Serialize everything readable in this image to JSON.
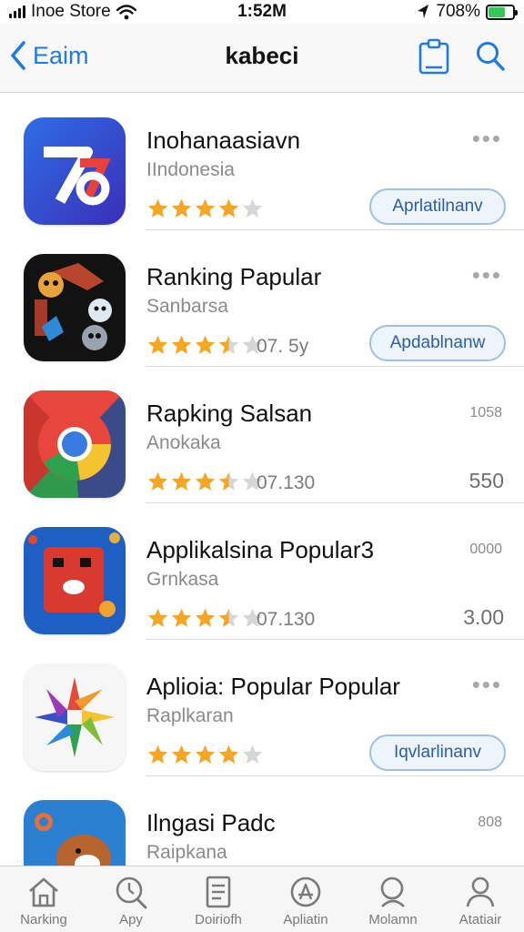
{
  "status_bar": {
    "carrier": "Inoe Store",
    "time": "1:52M",
    "battery": "708%"
  },
  "nav": {
    "back_label": "Eaim",
    "title": "kabeci"
  },
  "apps": [
    {
      "name": "Inohanaasiavn",
      "category": "IIndonesia",
      "rating": 4,
      "rating_count": "",
      "more": "•••",
      "action": "Aprlatilnanv",
      "price": ""
    },
    {
      "name": "Ranking Papular",
      "category": "Sanbarsa",
      "rating": 3.5,
      "rating_count": "07. 5y",
      "more": "•••",
      "action": "Apdablnanw",
      "price": ""
    },
    {
      "name": "Rapking Salsan",
      "category": "Anokaka",
      "rating": 3.5,
      "rating_count": "07.130",
      "more": "1058",
      "action": "",
      "price": "550"
    },
    {
      "name": "Applikalsina Popular3",
      "category": "Grnkasa",
      "rating": 3.5,
      "rating_count": "07.130",
      "more": "0000",
      "action": "",
      "price": "3.00"
    },
    {
      "name": "Aplioia: Popular Popular",
      "category": "Raplkaran",
      "rating": 4,
      "rating_count": "",
      "more": "•••",
      "action": "Iqvlarlinanv",
      "price": ""
    },
    {
      "name": "Ilngasi Padc",
      "category": "Raipkana",
      "rating": 0,
      "rating_count": "",
      "more": "808",
      "action": "",
      "price": ""
    }
  ],
  "tabs": [
    {
      "label": "Narking",
      "icon": "home-icon"
    },
    {
      "label": "Apy",
      "icon": "apps-icon"
    },
    {
      "label": "Doiriofh",
      "icon": "document-icon"
    },
    {
      "label": "Apliatin",
      "icon": "app-store-icon"
    },
    {
      "label": "Molamn",
      "icon": "search-icon"
    },
    {
      "label": "Atatiair",
      "icon": "profile-icon"
    }
  ],
  "colors": {
    "accent": "#1e7ae6",
    "star": "#f5a623",
    "star_empty": "#d6d6d6"
  }
}
